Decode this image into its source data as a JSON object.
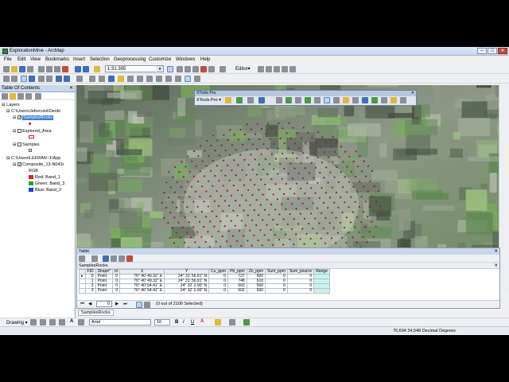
{
  "app": {
    "title": "ExplorationMine - ArcMap",
    "window_buttons": [
      "–",
      "□",
      "✕"
    ]
  },
  "menu": [
    "File",
    "Edit",
    "View",
    "Bookmarks",
    "Insert",
    "Selection",
    "Geoprocessing",
    "Customize",
    "Windows",
    "Help"
  ],
  "toolbar": {
    "scale": "1:31.395",
    "editor_label": "Editor▾"
  },
  "toc": {
    "title": "Table Of Contents",
    "root": "Layers",
    "folder1": "C:\\Users\\Jeforcoisi\\Deskt",
    "layer_samplesrocks": "SamplesRocks",
    "layer_explored": "Explored_Area",
    "layer_samples": "Samples",
    "folder2": "C:\\Users\\LEFRAN~1\\App",
    "raster": "Composite_13-N043r",
    "rgb": "RGB",
    "red": "Red:",
    "red_band": "Band_1",
    "green": "Green:",
    "green_band": "Band_3",
    "blue": "Blue:",
    "blue_band": "Band_2",
    "colors": {
      "red": "#e0201b",
      "green": "#1fa33a",
      "blue": "#1f3fd4"
    }
  },
  "xtools": {
    "title": "XTools Pro",
    "dropdown": "XTools Pro ▾"
  },
  "table": {
    "title": "Table",
    "name": "SamplesRocks",
    "columns": [
      "FID",
      "Shape*",
      "Id",
      "X",
      "Y",
      "Cu_ppm",
      "Pb_ppm",
      "Zn_ppm",
      "Sum_ppm",
      "Sum_pource",
      "Range"
    ],
    "rows": [
      [
        "0",
        "Point",
        "0",
        "76° 40' 49.32\" E",
        "24° 31' 56.91\" N",
        "0",
        "727",
        "600",
        "0",
        "0",
        ""
      ],
      [
        "1",
        "Point",
        "0",
        "76° 40' 49.32\" E",
        "24° 31' 56.91\" N",
        "0",
        "748",
        "610",
        "0",
        "0",
        ""
      ],
      [
        "2",
        "Point",
        "0",
        "76° 40' 54.41\" E",
        "24° 32' 2.00\" N",
        "0",
        "602",
        "500",
        "0",
        "0",
        ""
      ],
      [
        "3",
        "Point",
        "0",
        "76° 40' 54.41\" E",
        "24° 32' 2.00\" N",
        "0",
        "602",
        "500",
        "0",
        "0",
        ""
      ]
    ],
    "record": "0",
    "selection_status": "(0 out of 2100 Selected)",
    "tab": "SamplesRocks"
  },
  "drawing": {
    "label": "Drawing ▾",
    "font": "Arial",
    "size": "10",
    "bold": "B",
    "italic": "I",
    "underline": "U"
  },
  "status": {
    "coords": "76,694  24,548 Decimal Degrees"
  }
}
